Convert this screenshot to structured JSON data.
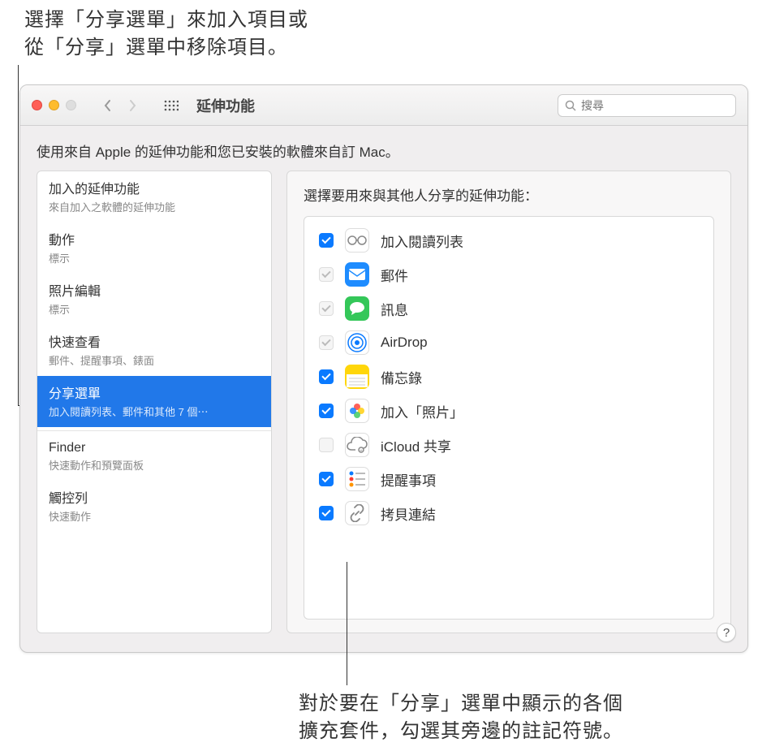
{
  "callouts": {
    "top": "選擇「分享選單」來加入項目或\n從「分享」選單中移除項目。",
    "bottom": "對於要在「分享」選單中顯示的各個\n擴充套件，勾選其旁邊的註記符號。"
  },
  "window": {
    "title": "延伸功能",
    "search_placeholder": "搜尋",
    "subtitle": "使用來自 Apple 的延伸功能和您已安裝的軟體來自訂 Mac。",
    "help": "?"
  },
  "sidebar": {
    "items": [
      {
        "title": "加入的延伸功能",
        "sub": "來自加入之軟體的延伸功能"
      },
      {
        "title": "動作",
        "sub": "標示"
      },
      {
        "title": "照片編輯",
        "sub": "標示"
      },
      {
        "title": "快速查看",
        "sub": "郵件、提醒事項、錶面"
      },
      {
        "title": "分享選單",
        "sub": "加入閱讀列表、郵件和其他 7 個⋯"
      },
      {
        "title": "Finder",
        "sub": "快速動作和預覽面板"
      },
      {
        "title": "觸控列",
        "sub": "快速動作"
      }
    ]
  },
  "main": {
    "title": "選擇要用來與其他人分享的延伸功能：",
    "extensions": [
      {
        "label": "加入閱讀列表",
        "checked": true,
        "disabled": false,
        "icon": "glasses",
        "bg": "#ffffff",
        "fg": "#888"
      },
      {
        "label": "郵件",
        "checked": true,
        "disabled": true,
        "icon": "mail",
        "bg": "#1e8cff",
        "fg": "#fff"
      },
      {
        "label": "訊息",
        "checked": true,
        "disabled": true,
        "icon": "messages",
        "bg": "#34c759",
        "fg": "#fff"
      },
      {
        "label": "AirDrop",
        "checked": true,
        "disabled": true,
        "icon": "airdrop",
        "bg": "#ffffff",
        "fg": "#0a7aff"
      },
      {
        "label": "備忘錄",
        "checked": true,
        "disabled": false,
        "icon": "notes",
        "bg": "#ffd60a",
        "fg": "#fff"
      },
      {
        "label": "加入「照片」",
        "checked": true,
        "disabled": false,
        "icon": "photos",
        "bg": "#ffffff",
        "fg": "#000"
      },
      {
        "label": "iCloud 共享",
        "checked": false,
        "disabled": true,
        "icon": "icloud-share",
        "bg": "#ffffff",
        "fg": "#888"
      },
      {
        "label": "提醒事項",
        "checked": true,
        "disabled": false,
        "icon": "reminders",
        "bg": "#ffffff",
        "fg": "#000"
      },
      {
        "label": "拷貝連結",
        "checked": true,
        "disabled": false,
        "icon": "link",
        "bg": "#ffffff",
        "fg": "#888"
      }
    ]
  }
}
